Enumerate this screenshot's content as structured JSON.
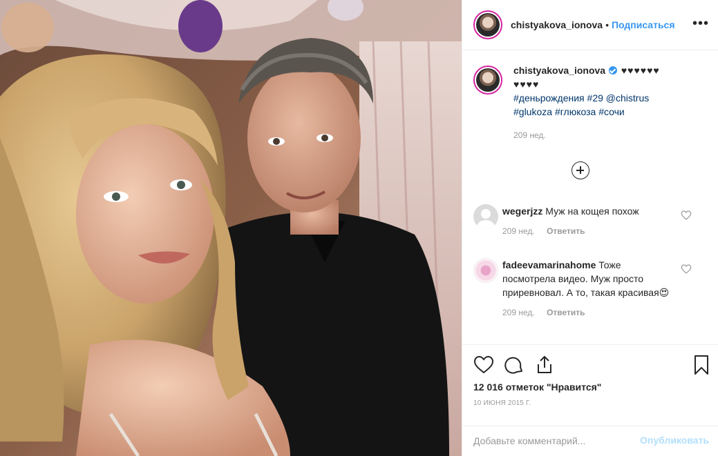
{
  "header": {
    "username": "chistyakova_ionova",
    "separator": "•",
    "follow_label": "Подписаться",
    "more_label": "•••"
  },
  "caption": {
    "username": "chistyakova_ionova",
    "hearts_line1": "♥♥♥♥♥♥",
    "hearts_line2": "♥♥♥♥",
    "tags": [
      "#деньрождения",
      "#29",
      "@chistrus",
      "#glukoza",
      "#глюкоза",
      "#сочи"
    ],
    "time": "209 нед."
  },
  "comments": [
    {
      "username": "wegerjzz",
      "text": "Муж на кощея похож",
      "time": "209 нед.",
      "reply_label": "Ответить"
    },
    {
      "username": "fadeevamarinahome",
      "text": "Тоже посмотрела видео. Муж просто приревновал. А то, такая красивая😍",
      "time": "209 нед.",
      "reply_label": "Ответить"
    }
  ],
  "likes_text": "12 016 отметок \"Нравится\"",
  "date_text": "10 ИЮНЯ 2015 Г.",
  "add_comment": {
    "placeholder": "Добавьте комментарий...",
    "publish_label": "Опубликовать"
  },
  "colors": {
    "link": "#3897f0",
    "hashtag": "#003569",
    "muted": "#999999",
    "publish_disabled": "#b2dffc",
    "story_ring": "#d6249f"
  }
}
